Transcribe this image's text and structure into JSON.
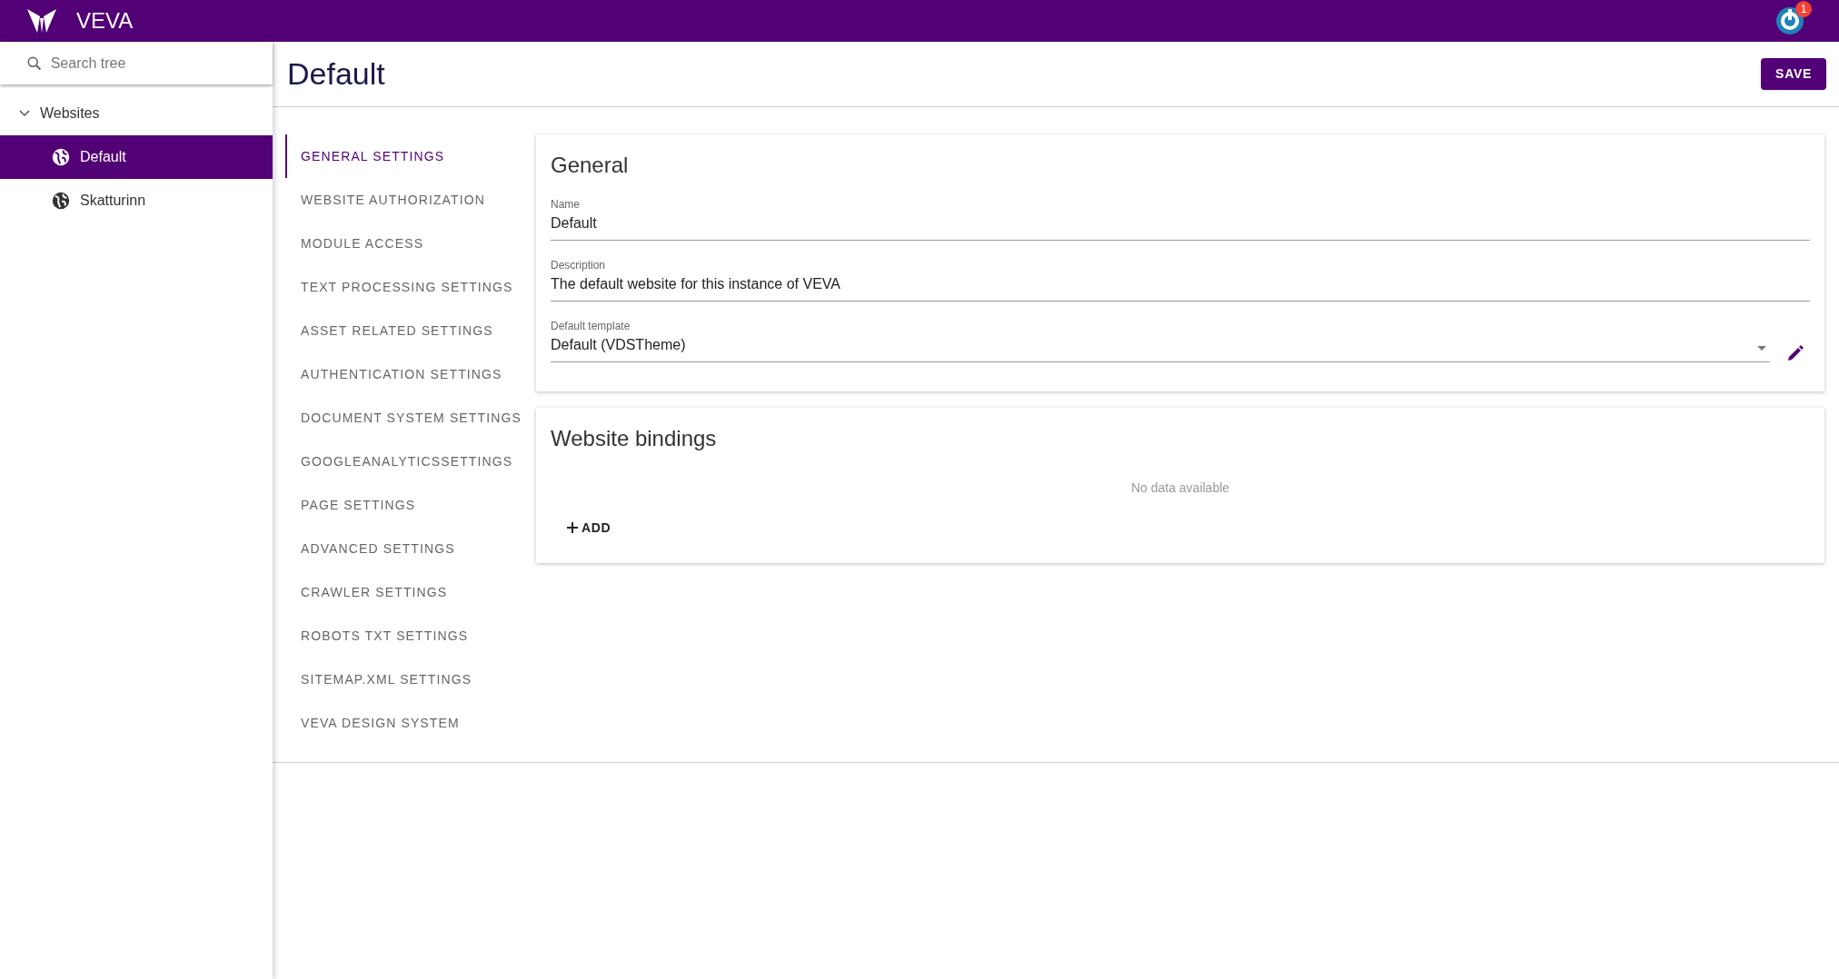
{
  "app_bar": {
    "title": "VEVA",
    "notification_count": "1"
  },
  "sidebar": {
    "search": {
      "placeholder": "Search tree"
    },
    "tree": [
      {
        "label": "Websites",
        "expanded": true,
        "selected": false,
        "children": [
          {
            "label": "Default",
            "selected": true
          },
          {
            "label": "Skatturinn",
            "selected": false
          }
        ]
      }
    ]
  },
  "page": {
    "title": "Default",
    "save_button": "SAVE"
  },
  "settings_nav": [
    {
      "label": "GENERAL SETTINGS",
      "selected": true
    },
    {
      "label": "WEBSITE AUTHORIZATION",
      "selected": false
    },
    {
      "label": "MODULE ACCESS",
      "selected": false
    },
    {
      "label": "TEXT PROCESSING SETTINGS",
      "selected": false
    },
    {
      "label": "ASSET RELATED SETTINGS",
      "selected": false
    },
    {
      "label": "AUTHENTICATION SETTINGS",
      "selected": false
    },
    {
      "label": "DOCUMENT SYSTEM SETTINGS",
      "selected": false
    },
    {
      "label": "GOOGLEANALYTICSSETTINGS",
      "selected": false
    },
    {
      "label": "PAGE SETTINGS",
      "selected": false
    },
    {
      "label": "ADVANCED SETTINGS",
      "selected": false
    },
    {
      "label": "CRAWLER SETTINGS",
      "selected": false
    },
    {
      "label": "ROBOTS TXT SETTINGS",
      "selected": false
    },
    {
      "label": "SITEMAP.XML SETTINGS",
      "selected": false
    },
    {
      "label": "VEVA DESIGN SYSTEM",
      "selected": false
    }
  ],
  "general": {
    "title": "General",
    "fields": [
      {
        "kind": "text",
        "label": "Name",
        "value": "Default"
      },
      {
        "kind": "text",
        "label": "Description",
        "value": "The default website for this instance of VEVA"
      },
      {
        "kind": "select",
        "label": "Default template",
        "value": "Default (VDSTheme)"
      }
    ]
  },
  "bindings": {
    "title": "Website bindings",
    "empty_text": "No data available",
    "add_button": "ADD"
  }
}
